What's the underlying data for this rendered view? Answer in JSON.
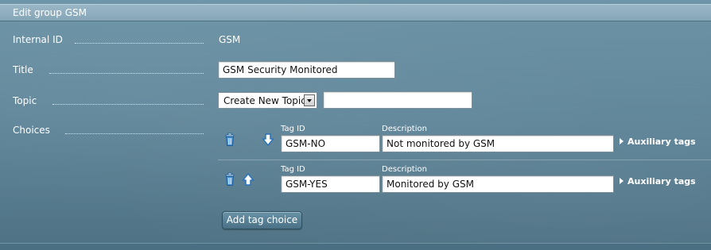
{
  "panel": {
    "title": "Edit group GSM"
  },
  "form": {
    "internal_id": {
      "label": "Internal ID",
      "value": "GSM"
    },
    "title": {
      "label": "Title",
      "value": "GSM Security Monitored"
    },
    "topic": {
      "label": "Topic",
      "selected": "Create New Topic",
      "new_topic_value": ""
    },
    "choices": {
      "label": "Choices",
      "items": [
        {
          "tag_id_label": "Tag ID",
          "tag_id": "GSM-NO",
          "description_label": "Description",
          "description": "Not monitored by GSM",
          "aux_label": "Auxiliary tags",
          "delete_icon": "trash-icon",
          "move_icon": "arrow-down-icon"
        },
        {
          "tag_id_label": "Tag ID",
          "tag_id": "GSM-YES",
          "description_label": "Description",
          "description": "Monitored by GSM",
          "aux_label": "Auxiliary tags",
          "delete_icon": "trash-icon",
          "move_icon": "arrow-up-icon"
        }
      ],
      "add_button_label": "Add tag choice"
    }
  },
  "colors": {
    "background": "#5e8498",
    "titlebar": "#8fafc0",
    "text": "#ffffff"
  }
}
